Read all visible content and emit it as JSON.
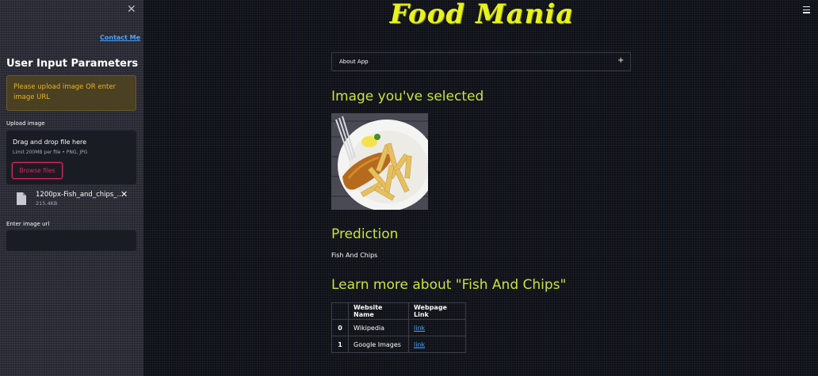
{
  "app": {
    "title": "Food Mania",
    "accent_color": "#c9e23a",
    "title_color": "#e8f21c"
  },
  "sidebar": {
    "close_icon": "close-icon",
    "contact_link": "Contact Me",
    "title": "User Input Parameters",
    "warning": "Please upload image OR enter image URL",
    "upload": {
      "label": "Upload image",
      "drop_text": "Drag and drop file here",
      "limit_text": "Limit 200MB per file • PNG, JPG",
      "browse_label": "Browse files"
    },
    "uploaded_file": {
      "name": "1200px-Fish_and_chips_...",
      "size": "215.4KB"
    },
    "url_input": {
      "label": "Enter image url",
      "value": ""
    }
  },
  "main": {
    "menu_icon": "hamburger-menu-icon",
    "expander": {
      "label": "About App",
      "icon": "plus-icon"
    },
    "selected_heading": "Image you've selected",
    "prediction_heading": "Prediction",
    "prediction_value": "Fish And Chips",
    "learn_more_heading": "Learn more about \"Fish And Chips\"",
    "table": {
      "columns": [
        "",
        "Website Name",
        "Webpage Link"
      ],
      "rows": [
        {
          "index": "0",
          "site": "Wikipedia",
          "link": "link"
        },
        {
          "index": "1",
          "site": "Google Images",
          "link": "link"
        }
      ]
    }
  }
}
